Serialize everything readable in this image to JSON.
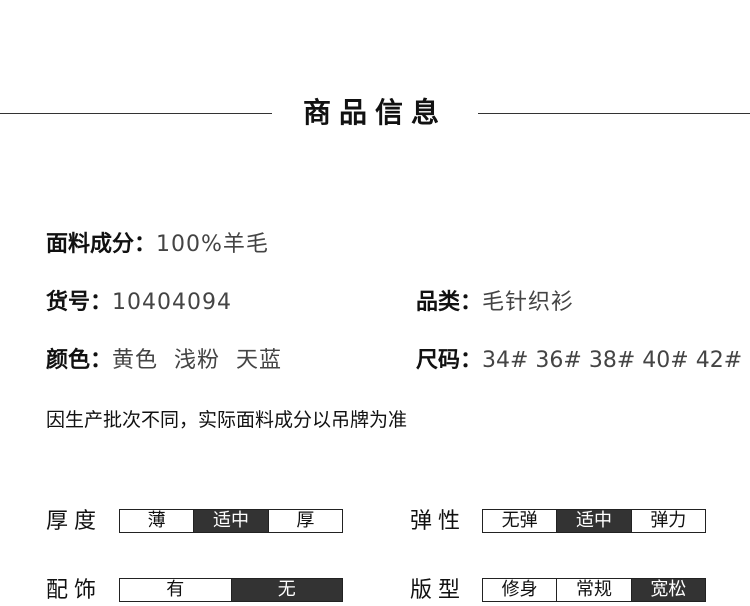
{
  "title": "商品信息",
  "fabric": {
    "label": "面料成分：",
    "value": "100%羊毛"
  },
  "item_no": {
    "label": "货号：",
    "value": "10404094"
  },
  "category": {
    "label": "品类：",
    "value": "毛针织衫"
  },
  "color": {
    "label": "颜色：",
    "value": "黄色  浅粉  天蓝"
  },
  "size": {
    "label": "尺码：",
    "value": "34# 36# 38# 40# 42#"
  },
  "note": "因生产批次不同，实际面料成分以吊牌为准",
  "thickness": {
    "label": "厚度",
    "options": [
      "薄",
      "适中",
      "厚"
    ],
    "selected": 1
  },
  "elasticity": {
    "label": "弹性",
    "options": [
      "无弹",
      "适中",
      "弹力"
    ],
    "selected": 1
  },
  "accessory": {
    "label": "配饰",
    "options": [
      "有",
      "无"
    ],
    "selected": 1
  },
  "fit": {
    "label": "版型",
    "options": [
      "修身",
      "常规",
      "宽松"
    ],
    "selected": 2
  },
  "colors": {
    "selected_bg": "#333333",
    "text": "#111111"
  }
}
